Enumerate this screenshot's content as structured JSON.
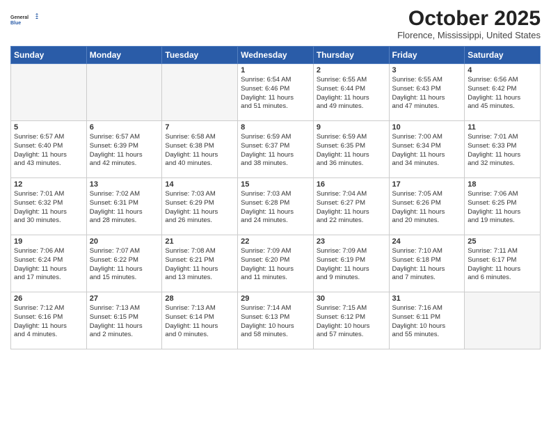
{
  "logo": {
    "general": "General",
    "blue": "Blue"
  },
  "title": "October 2025",
  "location": "Florence, Mississippi, United States",
  "headers": [
    "Sunday",
    "Monday",
    "Tuesday",
    "Wednesday",
    "Thursday",
    "Friday",
    "Saturday"
  ],
  "weeks": [
    [
      {
        "day": "",
        "text": ""
      },
      {
        "day": "",
        "text": ""
      },
      {
        "day": "",
        "text": ""
      },
      {
        "day": "1",
        "text": "Sunrise: 6:54 AM\nSunset: 6:46 PM\nDaylight: 11 hours\nand 51 minutes."
      },
      {
        "day": "2",
        "text": "Sunrise: 6:55 AM\nSunset: 6:44 PM\nDaylight: 11 hours\nand 49 minutes."
      },
      {
        "day": "3",
        "text": "Sunrise: 6:55 AM\nSunset: 6:43 PM\nDaylight: 11 hours\nand 47 minutes."
      },
      {
        "day": "4",
        "text": "Sunrise: 6:56 AM\nSunset: 6:42 PM\nDaylight: 11 hours\nand 45 minutes."
      }
    ],
    [
      {
        "day": "5",
        "text": "Sunrise: 6:57 AM\nSunset: 6:40 PM\nDaylight: 11 hours\nand 43 minutes."
      },
      {
        "day": "6",
        "text": "Sunrise: 6:57 AM\nSunset: 6:39 PM\nDaylight: 11 hours\nand 42 minutes."
      },
      {
        "day": "7",
        "text": "Sunrise: 6:58 AM\nSunset: 6:38 PM\nDaylight: 11 hours\nand 40 minutes."
      },
      {
        "day": "8",
        "text": "Sunrise: 6:59 AM\nSunset: 6:37 PM\nDaylight: 11 hours\nand 38 minutes."
      },
      {
        "day": "9",
        "text": "Sunrise: 6:59 AM\nSunset: 6:35 PM\nDaylight: 11 hours\nand 36 minutes."
      },
      {
        "day": "10",
        "text": "Sunrise: 7:00 AM\nSunset: 6:34 PM\nDaylight: 11 hours\nand 34 minutes."
      },
      {
        "day": "11",
        "text": "Sunrise: 7:01 AM\nSunset: 6:33 PM\nDaylight: 11 hours\nand 32 minutes."
      }
    ],
    [
      {
        "day": "12",
        "text": "Sunrise: 7:01 AM\nSunset: 6:32 PM\nDaylight: 11 hours\nand 30 minutes."
      },
      {
        "day": "13",
        "text": "Sunrise: 7:02 AM\nSunset: 6:31 PM\nDaylight: 11 hours\nand 28 minutes."
      },
      {
        "day": "14",
        "text": "Sunrise: 7:03 AM\nSunset: 6:29 PM\nDaylight: 11 hours\nand 26 minutes."
      },
      {
        "day": "15",
        "text": "Sunrise: 7:03 AM\nSunset: 6:28 PM\nDaylight: 11 hours\nand 24 minutes."
      },
      {
        "day": "16",
        "text": "Sunrise: 7:04 AM\nSunset: 6:27 PM\nDaylight: 11 hours\nand 22 minutes."
      },
      {
        "day": "17",
        "text": "Sunrise: 7:05 AM\nSunset: 6:26 PM\nDaylight: 11 hours\nand 20 minutes."
      },
      {
        "day": "18",
        "text": "Sunrise: 7:06 AM\nSunset: 6:25 PM\nDaylight: 11 hours\nand 19 minutes."
      }
    ],
    [
      {
        "day": "19",
        "text": "Sunrise: 7:06 AM\nSunset: 6:24 PM\nDaylight: 11 hours\nand 17 minutes."
      },
      {
        "day": "20",
        "text": "Sunrise: 7:07 AM\nSunset: 6:22 PM\nDaylight: 11 hours\nand 15 minutes."
      },
      {
        "day": "21",
        "text": "Sunrise: 7:08 AM\nSunset: 6:21 PM\nDaylight: 11 hours\nand 13 minutes."
      },
      {
        "day": "22",
        "text": "Sunrise: 7:09 AM\nSunset: 6:20 PM\nDaylight: 11 hours\nand 11 minutes."
      },
      {
        "day": "23",
        "text": "Sunrise: 7:09 AM\nSunset: 6:19 PM\nDaylight: 11 hours\nand 9 minutes."
      },
      {
        "day": "24",
        "text": "Sunrise: 7:10 AM\nSunset: 6:18 PM\nDaylight: 11 hours\nand 7 minutes."
      },
      {
        "day": "25",
        "text": "Sunrise: 7:11 AM\nSunset: 6:17 PM\nDaylight: 11 hours\nand 6 minutes."
      }
    ],
    [
      {
        "day": "26",
        "text": "Sunrise: 7:12 AM\nSunset: 6:16 PM\nDaylight: 11 hours\nand 4 minutes."
      },
      {
        "day": "27",
        "text": "Sunrise: 7:13 AM\nSunset: 6:15 PM\nDaylight: 11 hours\nand 2 minutes."
      },
      {
        "day": "28",
        "text": "Sunrise: 7:13 AM\nSunset: 6:14 PM\nDaylight: 11 hours\nand 0 minutes."
      },
      {
        "day": "29",
        "text": "Sunrise: 7:14 AM\nSunset: 6:13 PM\nDaylight: 10 hours\nand 58 minutes."
      },
      {
        "day": "30",
        "text": "Sunrise: 7:15 AM\nSunset: 6:12 PM\nDaylight: 10 hours\nand 57 minutes."
      },
      {
        "day": "31",
        "text": "Sunrise: 7:16 AM\nSunset: 6:11 PM\nDaylight: 10 hours\nand 55 minutes."
      },
      {
        "day": "",
        "text": ""
      }
    ]
  ]
}
